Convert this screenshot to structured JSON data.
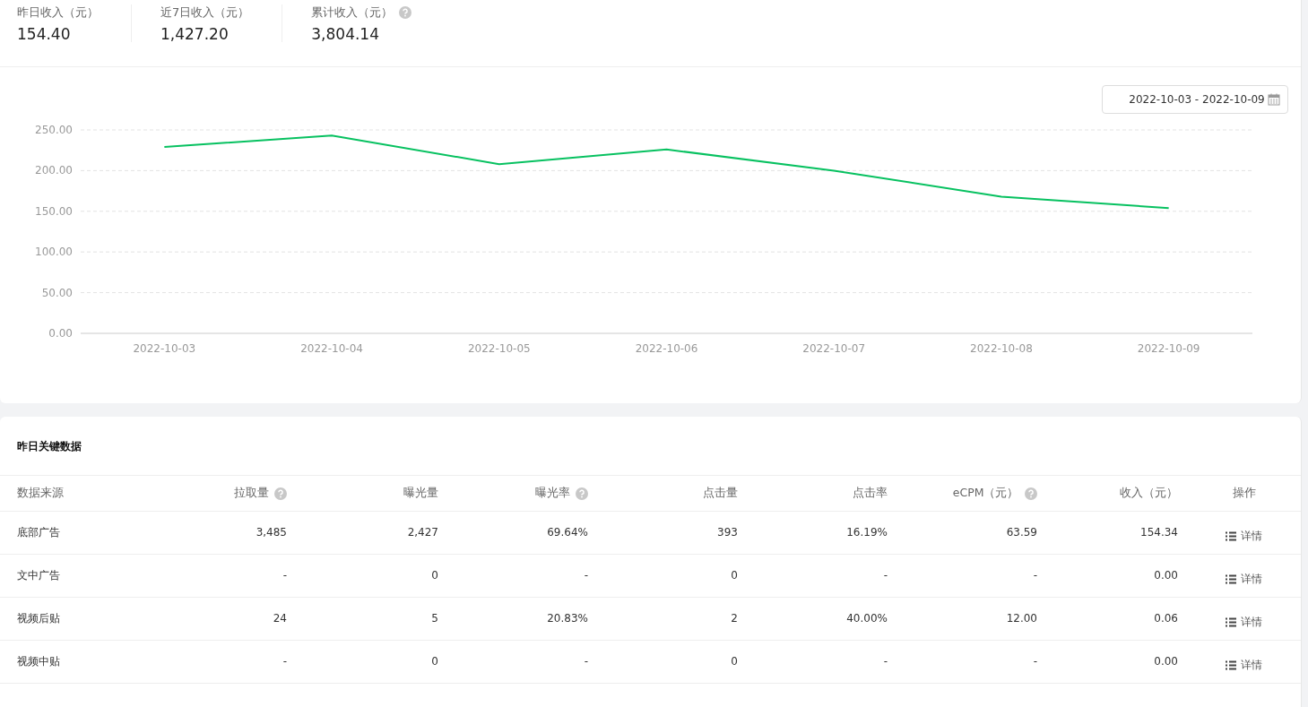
{
  "stats": [
    {
      "label": "昨日收入（元）",
      "value": "154.40",
      "has_help": false
    },
    {
      "label": "近7日收入（元）",
      "value": "1,427.20",
      "has_help": false
    },
    {
      "label": "累计收入（元）",
      "value": "3,804.14",
      "has_help": true
    }
  ],
  "date_range": {
    "value": "2022-10-03 - 2022-10-09"
  },
  "chart_data": {
    "type": "line",
    "categories": [
      "2022-10-03",
      "2022-10-04",
      "2022-10-05",
      "2022-10-06",
      "2022-10-07",
      "2022-10-08",
      "2022-10-09"
    ],
    "series": [
      {
        "color": "#07c160",
        "values": [
          229,
          243,
          208,
          226,
          200,
          168,
          154
        ]
      }
    ],
    "grid": true,
    "ylim": [
      0,
      250
    ],
    "yticks": [
      {
        "value": 0,
        "label": "0.00"
      },
      {
        "value": 50,
        "label": "50.00"
      },
      {
        "value": 100,
        "label": "100.00"
      },
      {
        "value": 150,
        "label": "150.00"
      },
      {
        "value": 200,
        "label": "200.00"
      },
      {
        "value": 250,
        "label": "250.00"
      }
    ]
  },
  "table": {
    "title": "昨日关键数据",
    "columns": [
      {
        "label": "数据来源",
        "has_help": false
      },
      {
        "label": "拉取量",
        "has_help": true
      },
      {
        "label": "曝光量",
        "has_help": false
      },
      {
        "label": "曝光率",
        "has_help": true
      },
      {
        "label": "点击量",
        "has_help": false
      },
      {
        "label": "点击率",
        "has_help": false
      },
      {
        "label": "eCPM（元）",
        "has_help": true
      },
      {
        "label": "收入（元）",
        "has_help": false
      },
      {
        "label": "操作",
        "has_help": false
      }
    ],
    "rows": [
      {
        "cells": [
          "底部广告",
          "3,485",
          "2,427",
          "69.64%",
          "393",
          "16.19%",
          "63.59",
          "154.34"
        ],
        "action": "详情"
      },
      {
        "cells": [
          "文中广告",
          "-",
          "0",
          "-",
          "0",
          "-",
          "-",
          "0.00"
        ],
        "action": "详情"
      },
      {
        "cells": [
          "视频后贴",
          "24",
          "5",
          "20.83%",
          "2",
          "40.00%",
          "12.00",
          "0.06"
        ],
        "action": "详情"
      },
      {
        "cells": [
          "视频中贴",
          "-",
          "0",
          "-",
          "0",
          "-",
          "-",
          "0.00"
        ],
        "action": "详情"
      }
    ]
  }
}
